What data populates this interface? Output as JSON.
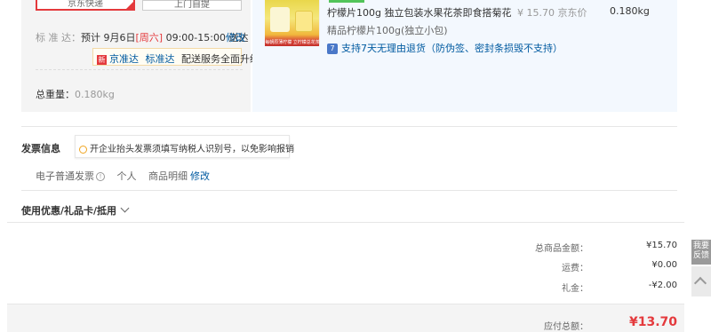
{
  "delivery": {
    "buttons": [
      "京东快递",
      "上门自提"
    ],
    "standard_label": "标 准 达：",
    "standard_detail_prefix": "预计 9月6日",
    "standard_weekday": "[周六]",
    "standard_detail_suffix": " 09:00-15:00 送达",
    "modify": "修改",
    "badge_xin": "新",
    "badge_items": [
      "京准达",
      "标准达"
    ],
    "badge_text": "配送服务全面升级",
    "weight_label": "总重量：",
    "weight_value": "0.180kg"
  },
  "product": {
    "img_text": "每朝原薄柠檬 立柠檬总花茶",
    "price_hidden": "¥15.70 京东价",
    "title": "柠檬片100g 独立包装水果花茶即食搭菊花",
    "price_line": "¥ 15.70 京东价",
    "weight": "0.180kg",
    "spec": "精品柠檬片100g(独立小包)",
    "return_icon": "7",
    "return_text": "支持7天无理由退货（防伪签、密封条损毁不支持）"
  },
  "invoice": {
    "title": "发票信息",
    "tip": "开企业抬头发票须填写纳税人识别号，以免影响报销",
    "type": "电子普通发票",
    "info_icon": "!",
    "owner": "个人",
    "detail": "商品明细",
    "modify": "修改"
  },
  "coupon": {
    "title": "使用优惠/礼品卡/抵用"
  },
  "totals": {
    "rows": [
      {
        "label": "总商品金额：",
        "value": "¥15.70"
      },
      {
        "label": "运费：",
        "value": "¥0.00"
      },
      {
        "label": "礼金：",
        "value": "-¥2.00"
      }
    ],
    "payable_label": "应付总额：",
    "payable_value": "¥13.70"
  },
  "sidebar": {
    "feedback": "我要反馈"
  },
  "colors": {
    "accent": "#e4393c",
    "link": "#005aa0"
  }
}
